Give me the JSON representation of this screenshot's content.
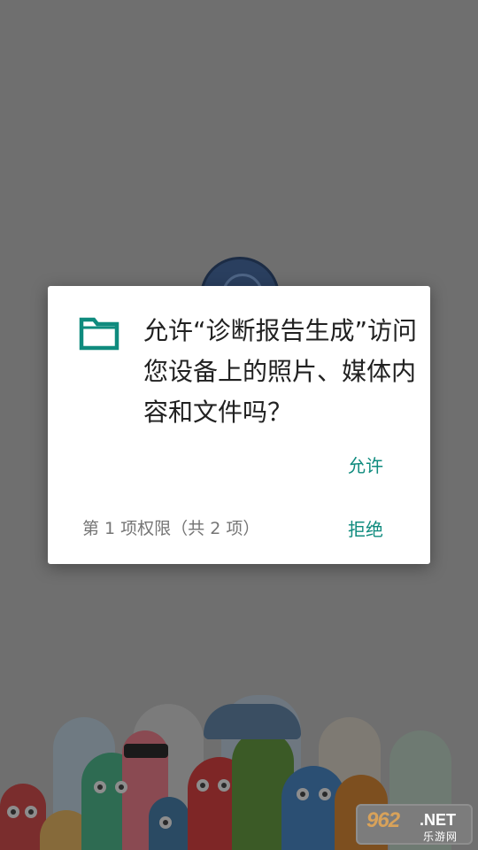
{
  "permission_dialog": {
    "message": "允许“诊断报告生成”访问您设备上的照片、媒体内容和文件吗？",
    "allow_label": "允许",
    "deny_label": "拒绝",
    "counter_text": "第 1 项权限（共 2 项）",
    "icon": "folder-icon",
    "accent_color": "#0f8b7e"
  },
  "watermark": {
    "number": "962",
    "net": ".NET",
    "site_name": "乐游网"
  }
}
